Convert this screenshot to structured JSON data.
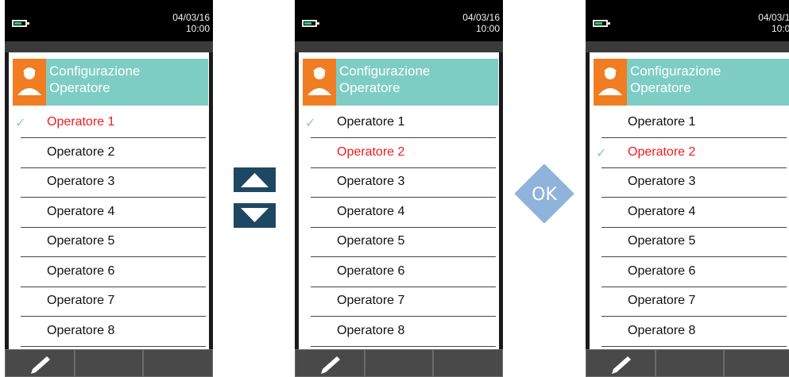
{
  "status": {
    "date": "04/03/16",
    "time": "10:00"
  },
  "header": {
    "title_line1": "Configurazione",
    "title_line2": "Operatore"
  },
  "screens": [
    {
      "selected_index": 0,
      "checked_index": 0
    },
    {
      "selected_index": 1,
      "checked_index": 0
    },
    {
      "selected_index": 1,
      "checked_index": 1
    }
  ],
  "operators": [
    "Operatore 1",
    "Operatore 2",
    "Operatore 3",
    "Operatore 4",
    "Operatore 5",
    "Operatore 6",
    "Operatore 7",
    "Operatore 8"
  ],
  "icons": {
    "up": "arrow-up-icon",
    "down": "arrow-down-icon",
    "ok": "ok-key-icon",
    "edit": "pencil-icon",
    "check": "check-icon"
  },
  "ok_label": "OK",
  "check_glyph": "✓",
  "colors": {
    "header": "#7ecdc4",
    "icon_bg": "#f07d22",
    "selected_text": "#ee1c1c",
    "nav_button": "#1e4763",
    "ok_button": "#8fb3db"
  }
}
